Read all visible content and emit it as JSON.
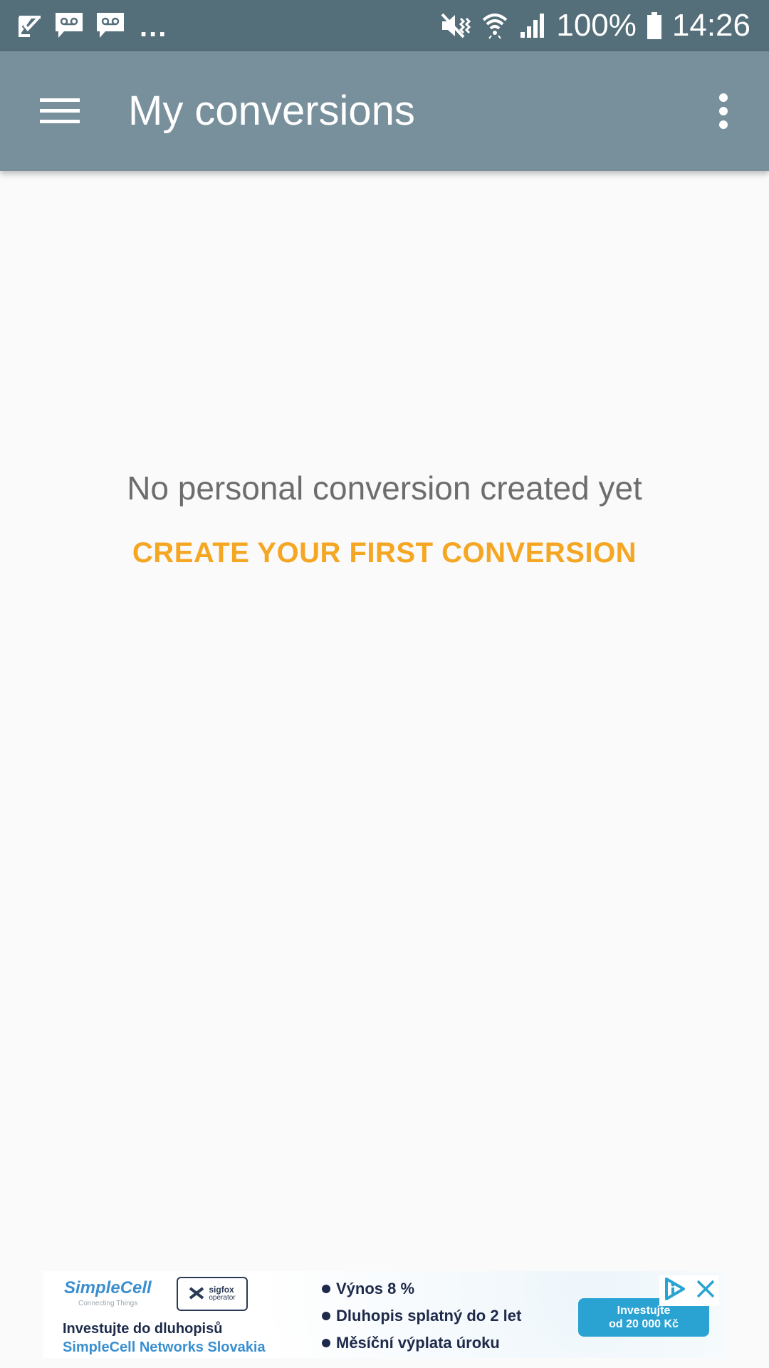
{
  "status_bar": {
    "icons_left": [
      "check-notification-icon",
      "voicemail-icon",
      "voicemail-icon"
    ],
    "ellipsis": "...",
    "icons_right": [
      "mute-vibrate-icon",
      "wifi-icon",
      "signal-icon",
      "battery-icon"
    ],
    "battery": "100%",
    "time": "14:26"
  },
  "app_bar": {
    "title": "My conversions",
    "menu_icon": "hamburger-menu-icon",
    "overflow_icon": "more-vert-icon"
  },
  "empty_state": {
    "message": "No personal conversion created yet",
    "action_label": "CREATE YOUR FIRST CONVERSION"
  },
  "ad": {
    "brand": "SimpleCell",
    "brand_tagline": "Connecting Things",
    "partner": "sigfox",
    "partner_sub": "operator",
    "line1": "Investujte do dluhopisů",
    "line2": "SimpleCell Networks Slovakia",
    "bullets": [
      "Výnos 8 %",
      "Dluhopis splatný do 2 let",
      "Měsíční výplata úroku"
    ],
    "cta_line1": "Investujte",
    "cta_line2": "od 20 000 Kč"
  },
  "colors": {
    "status_bar": "#546e7a",
    "app_bar": "#78909c",
    "accent": "#f5a623",
    "background": "#fafafa"
  }
}
